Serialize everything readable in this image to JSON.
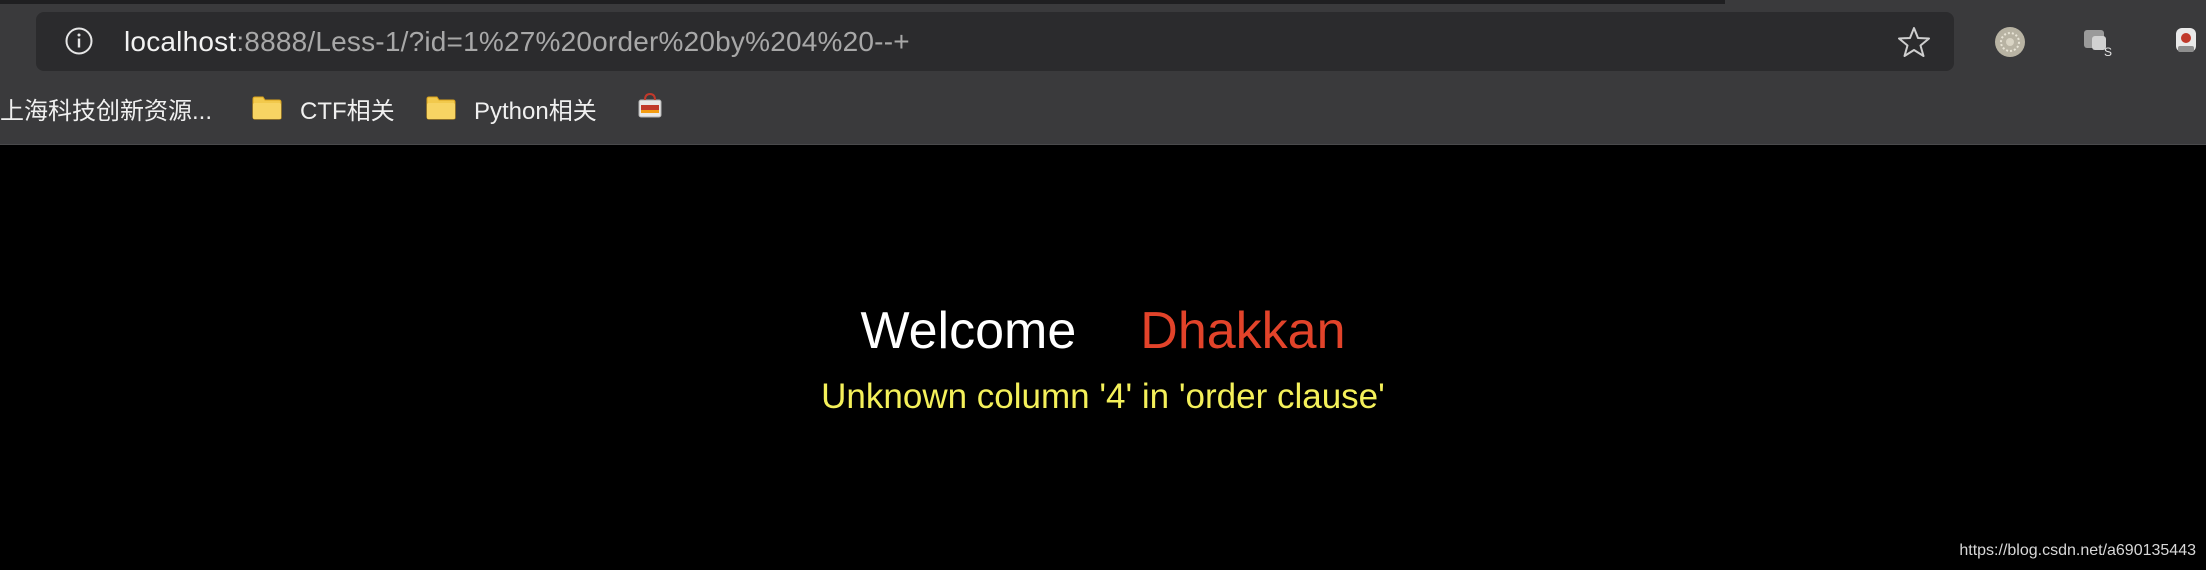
{
  "browser": {
    "address_bar": {
      "url_host": "localhost",
      "url_rest": ":8888/Less-1/?id=1%27%20order%20by%204%20--+"
    },
    "icons": [
      "info-icon",
      "star-icon",
      "extension-globe-icon",
      "extension-puzzle-icon",
      "extension-user-icon"
    ],
    "bookmarks": [
      {
        "label": "上海科技创新资源...",
        "icon": "none"
      },
      {
        "label": "CTF相关",
        "icon": "folder-icon"
      },
      {
        "label": "Python相关",
        "icon": "folder-icon"
      },
      {
        "label": "",
        "icon": "shopping-bag-icon"
      }
    ]
  },
  "page": {
    "welcome_word": "Welcome",
    "welcome_name": "Dhakkan",
    "error_message": "Unknown column '4' in 'order clause'"
  },
  "watermark": "https://blog.csdn.net/a690135443",
  "colors": {
    "background": "#000000",
    "welcome": "#ffffff",
    "name": "#e2432a",
    "error": "#f4f05a"
  }
}
